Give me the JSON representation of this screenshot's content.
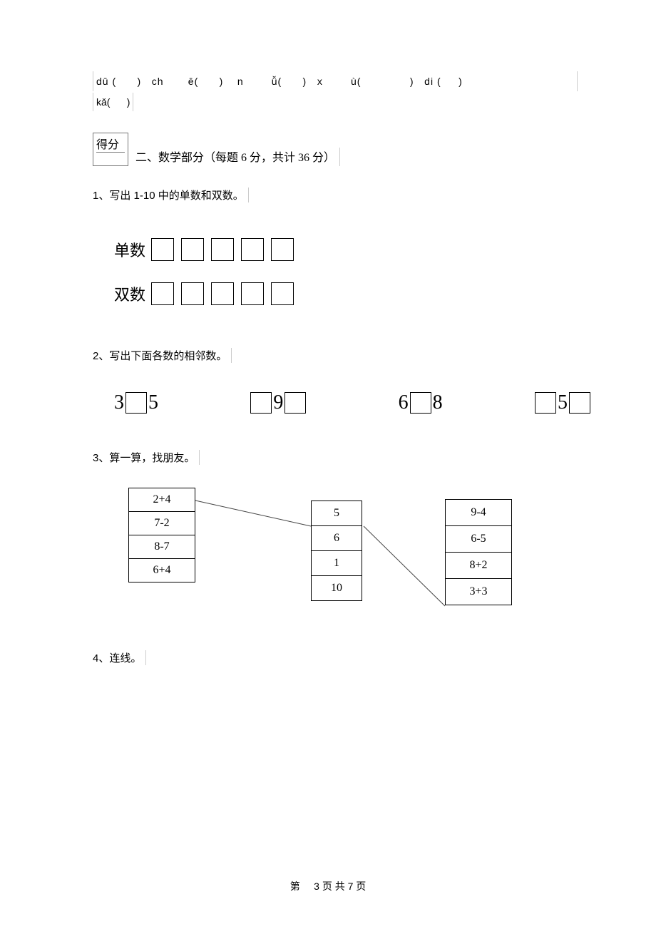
{
  "pinyin": {
    "line1": "dū (      )   ch       ē(      )    n        ǚ(      )   x        ù(              )   di (     )",
    "line2": "kǎ(      )"
  },
  "score_label": "得分",
  "section2_title": "二、数学部分（每题 6 分，共计 36 分）",
  "q1": "1、写出 1-10 中的单数和双数。",
  "odd_label": "单数",
  "even_label": "双数",
  "q2": "2、写出下面各数的相邻数。",
  "neighbors": {
    "g1_left": "3",
    "g1_right": "5",
    "g2_mid": "9",
    "g3_left": "6",
    "g3_right": "8",
    "g4_mid": "5"
  },
  "q3": "3、算一算，找朋友。",
  "match": {
    "col1": [
      "2+4",
      "7-2",
      "8-7",
      "6+4"
    ],
    "col2": [
      "5",
      "6",
      "1",
      "10"
    ],
    "col3": [
      "9-4",
      "6-5",
      "8+2",
      "3+3"
    ]
  },
  "q4": "4、连线。",
  "footer": {
    "prefix": "第",
    "page": "3 页 共 7 页"
  }
}
